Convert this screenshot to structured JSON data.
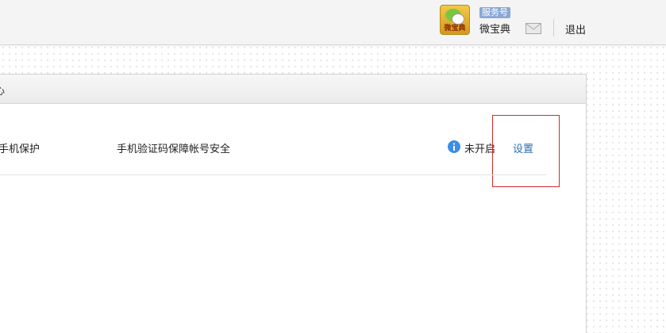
{
  "header": {
    "avatar_text": "微宝典",
    "account_type_badge": "服务号",
    "account_name": "微宝典",
    "logout_label": "退出"
  },
  "panel": {
    "title_fragment": "心"
  },
  "security_row": {
    "title": "手机保护",
    "description": "手机验证码保障帐号安全",
    "status": "未开启",
    "action_label": "设置",
    "icons": [
      "info-icon"
    ]
  },
  "colors": {
    "link": "#2b6fb3",
    "info_icon": "#3a8ee6",
    "badge_bg": "#8aa8d6",
    "highlight_border": "#d42a2a"
  }
}
